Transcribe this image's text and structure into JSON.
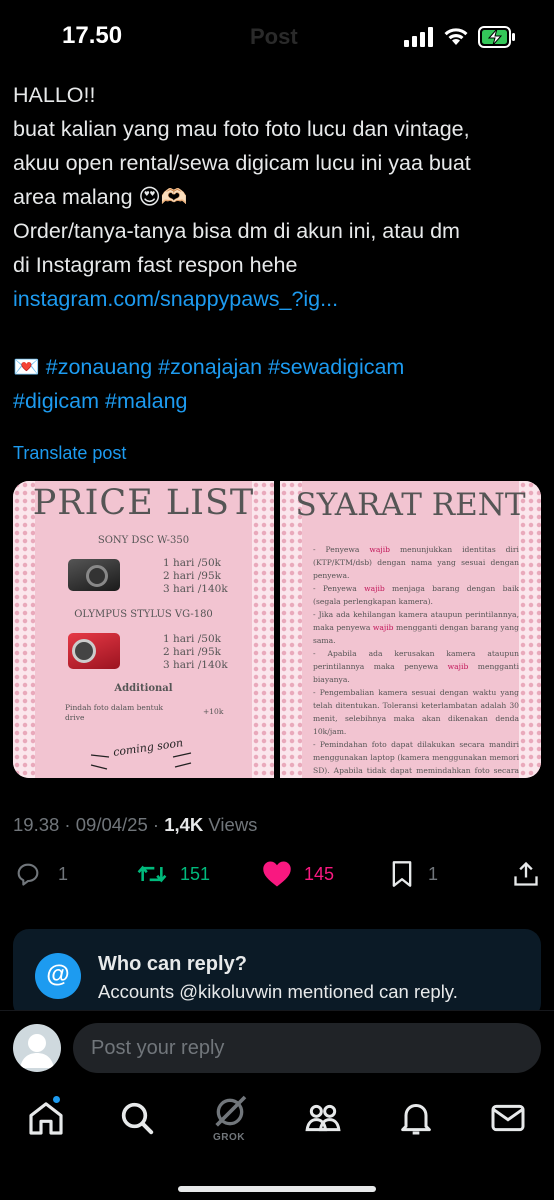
{
  "status_bar": {
    "time": "17.50",
    "header_title": "Post"
  },
  "post": {
    "lines": [
      "HALLO!!",
      "buat kalian yang mau foto foto lucu dan vintage,",
      "akuu open rental/sewa digicam lucu ini yaa buat",
      "area malang 😍🫶🏻",
      "Order/tanya-tanya bisa dm di akun ini, atau dm",
      "di Instagram fast respon hehe"
    ],
    "link": "instagram.com/snappypaws_?ig...",
    "hashtag_line_1": "💌 #zonauang #zonajajan #sewadigicam",
    "hashtag_line_2": "#digicam #malang",
    "translate_label": "Translate post"
  },
  "media": {
    "price_list": {
      "title": "PRICE LIST",
      "camera_1": "SONY DSC W-350",
      "camera_1_prices": [
        "1 hari /50k",
        "2 hari /95k",
        "3 hari /140k"
      ],
      "camera_2": "OLYMPUS STYLUS VG-180",
      "camera_2_prices": [
        "1 hari /50k",
        "2 hari /95k",
        "3 hari /140k"
      ],
      "additional_title": "Additional",
      "additional_text": "Pindah foto dalam bentuk drive",
      "additional_price": "+10k",
      "coming_soon": "coming soon"
    },
    "syarat_rent": {
      "title": "SYARAT RENT",
      "items": [
        "- Penyewa wajib menunjukkan identitas diri (KTP/KTM/dsb) dengan nama yang sesuai dengan penyewa.",
        "- Penyewa wajib menjaga barang dengan baik (segala perlengkapan kamera).",
        "- Jika ada kehilangan kamera ataupun perintilannya, maka penyewa wajib mengganti dengan barang yang sama.",
        "- Apabila ada kerusakan kamera ataupun perintilannya maka penyewa wajib mengganti biayanya.",
        "- Pengembalian kamera sesuai dengan waktu yang telah ditentukan. Toleransi keterlambatan adalah 30 menit, selebihnya maka akan dikenakan denda 10k/jam.",
        "- Pemindahan foto dapat dilakukan secara mandiri menggunakan laptop (kamera menggunakan memori SD). Apabila tidak dapat memindahkan foto secara mandiri @snappypaws_"
      ]
    }
  },
  "meta": {
    "timestamp": "19.38 · 09/04/25 · ",
    "views_count": "1,4K",
    "views_label": " Views"
  },
  "actions": {
    "replies": "1",
    "reposts": "151",
    "likes": "145",
    "bookmarks": "1",
    "repost_color": "#00ba7c",
    "like_color": "#f91880"
  },
  "who_can_reply": {
    "title": "Who can reply?",
    "subtitle": "Accounts @kikoluvwin mentioned can reply."
  },
  "reply": {
    "placeholder": "Post your reply"
  },
  "nav": {
    "grok_label": "GROK"
  },
  "icons": [
    "signal-icon",
    "wifi-icon",
    "battery-charging-icon",
    "reply-icon",
    "repost-icon",
    "heart-icon",
    "bookmark-icon",
    "share-icon",
    "at-icon",
    "home-icon",
    "search-icon",
    "grok-icon",
    "communities-icon",
    "notifications-icon",
    "messages-icon"
  ]
}
